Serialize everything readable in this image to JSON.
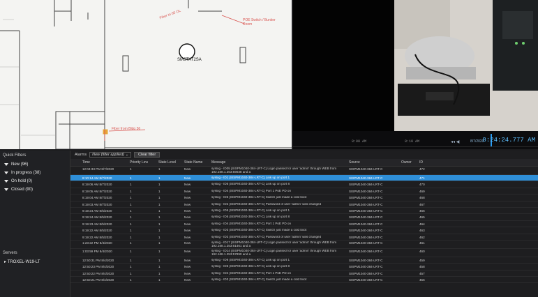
{
  "map": {
    "device_label": "SMSTAT2SA",
    "annotations": [
      "Fiber to 60 OL",
      "POE Switch / Bunker Room",
      "Fiber from Bldg 36"
    ]
  },
  "video": {
    "timeline_ticks": [
      "8:00 AM",
      "8:10 AM"
    ],
    "date": "8/7/2020",
    "current_time": "8:24:24.777 AM"
  },
  "sidebar": {
    "title": "Quick Filters",
    "filters": [
      {
        "label": "New (96)"
      },
      {
        "label": "In progress (38)"
      },
      {
        "label": "On hold (0)"
      },
      {
        "label": "Closed (90)"
      }
    ],
    "servers_title": "Servers",
    "servers": [
      "TROXEL-W19-LT"
    ]
  },
  "toolbar": {
    "alarms_label": "Alarms",
    "filter_value": "New (filter applied)",
    "clear_label": "Clear filter"
  },
  "table": {
    "columns": {
      "time": "Time",
      "priority": "Priority Level",
      "state": "State Level",
      "state_name": "State Name",
      "message": "Message",
      "source": "Source",
      "owner": "Owner",
      "id": "ID"
    },
    "rows": [
      {
        "video": true,
        "time": "12:04:33 PM 8/7/2020",
        "priority": "1",
        "state": "1",
        "state_name": "New",
        "message": "syslog - ID05 [SISPM1040-384-LRT-C] Login passed for user 'admin' through WEB from 192.168.1.253:59038 and a",
        "source": "SISPM1040-384-LRT-C",
        "owner": "",
        "id": "472",
        "tall": true
      },
      {
        "video": true,
        "time": "8:10:14 AM 8/7/2020",
        "priority": "1",
        "state": "1",
        "state_name": "New",
        "message": "syslog - ID1 [SISPM1040-384-LRT-C] Link up on port 1",
        "source": "SISPM1040-384-LRT-C",
        "owner": "",
        "id": "471",
        "selected": true
      },
      {
        "video": true,
        "time": "8:19:06 AM 8/7/2020",
        "priority": "1",
        "state": "1",
        "state_name": "New",
        "message": "syslog - ID5 [SISPM1040-384-LRT-C] Link up on port 8",
        "source": "SISPM1040-384-LRT-C",
        "owner": "",
        "id": "470"
      },
      {
        "video": true,
        "time": "8:19:05 AM 8/7/2020",
        "priority": "1",
        "state": "1",
        "state_name": "New",
        "message": "syslog - ID4 [SISPM1040-384-LRT-C] Port 1 PoE PD on",
        "source": "SISPM1040-384-LRT-C",
        "owner": "",
        "id": "469"
      },
      {
        "video": false,
        "time": "8:19:04 AM 8/7/2020",
        "priority": "1",
        "state": "1",
        "state_name": "New",
        "message": "syslog - ID3 [SISPM1040-384-LRT-C] Switch just made a cold boot",
        "source": "SISPM1040-384-LRT-C",
        "owner": "",
        "id": "468"
      },
      {
        "video": false,
        "time": "8:19:03 AM 8/7/2020",
        "priority": "1",
        "state": "1",
        "state_name": "New",
        "message": "syslog - ID2 [SISPM1040-384-LRT-C] Password of user 'admin' was changed",
        "source": "SISPM1040-384-LRT-C",
        "owner": "",
        "id": "467"
      },
      {
        "video": true,
        "time": "9:19:24 AM 8/5/2020",
        "priority": "1",
        "state": "1",
        "state_name": "New",
        "message": "syslog - ID5 [SISPM1040-384-LRT-C] Link up on port 1",
        "source": "SISPM1040-384-LRT-C",
        "owner": "",
        "id": "466"
      },
      {
        "video": true,
        "time": "9:19:24 AM 8/5/2020",
        "priority": "1",
        "state": "1",
        "state_name": "New",
        "message": "syslog - ID5 [SISPM1040-384-LRT-C] Link up on port 8",
        "source": "SISPM1040-384-LRT-C",
        "owner": "",
        "id": "465"
      },
      {
        "video": true,
        "time": "9:19:23 AM 8/5/2020",
        "priority": "1",
        "state": "1",
        "state_name": "New",
        "message": "syslog - ID4 [SISPM1040-384-LRT-C] Port 1 PoE PD on",
        "source": "SISPM1040-384-LRT-C",
        "owner": "",
        "id": "464"
      },
      {
        "video": false,
        "time": "9:19:22 AM 8/5/2020",
        "priority": "1",
        "state": "1",
        "state_name": "New",
        "message": "syslog - ID3 [SISPM1040-384-LRT-C] Switch just made a cold boot",
        "source": "SISPM1040-384-LRT-C",
        "owner": "",
        "id": "463"
      },
      {
        "video": false,
        "time": "9:19:22 AM 8/5/2020",
        "priority": "1",
        "state": "1",
        "state_name": "New",
        "message": "syslog - ID2 [SISPM1040-384-LRT-C] Password of user 'admin' was changed",
        "source": "SISPM1040-384-LRT-C",
        "owner": "",
        "id": "462"
      },
      {
        "video": false,
        "time": "1:23:22 PM 8/4/2020",
        "priority": "1",
        "state": "1",
        "state_name": "New",
        "message": "syslog - ID17 [SISPM1040-384-LRT-C] Login passed for user 'admin' through WEB from 192.168.1.253:61461 and a",
        "source": "SISPM1040-384-LRT-C",
        "owner": "",
        "id": "461",
        "tall": true
      },
      {
        "video": false,
        "time": "1:03:59 PM 8/4/2020",
        "priority": "1",
        "state": "1",
        "state_name": "New",
        "message": "syslog - ID14 [SISPM1040-384-LRT-C] Login passed for user 'admin' through WEB from 192.168.1.253:57890 and a",
        "source": "SISPM1040-384-LRT-C",
        "owner": "",
        "id": "460",
        "tall": true
      },
      {
        "video": true,
        "time": "12:50:31 PM 8/4/2020",
        "priority": "1",
        "state": "1",
        "state_name": "New",
        "message": "syslog - ID6 [SISPM1040-384-LRT-C] Link up on port 1",
        "source": "SISPM1040-384-LRT-C",
        "owner": "",
        "id": "459"
      },
      {
        "video": true,
        "time": "12:50:23 PM 8/4/2020",
        "priority": "1",
        "state": "1",
        "state_name": "New",
        "message": "syslog - ID5 [SISPM1040-384-LRT-C] Link up on port 8",
        "source": "SISPM1040-384-LRT-C",
        "owner": "",
        "id": "458"
      },
      {
        "video": false,
        "time": "12:50:22 PM 8/4/2020",
        "priority": "1",
        "state": "1",
        "state_name": "New",
        "message": "syslog - ID4 [SISPM1040-384-LRT-C] Port 1 PoE PD on",
        "source": "SISPM1040-384-LRT-C",
        "owner": "",
        "id": "457"
      },
      {
        "video": false,
        "time": "12:50:21 PM 8/4/2020",
        "priority": "1",
        "state": "1",
        "state_name": "New",
        "message": "syslog - ID3 [SISPM1040-384-LRT-C] Switch just made a cold boot",
        "source": "SISPM1040-384-LRT-C",
        "owner": "",
        "id": "456"
      }
    ]
  }
}
